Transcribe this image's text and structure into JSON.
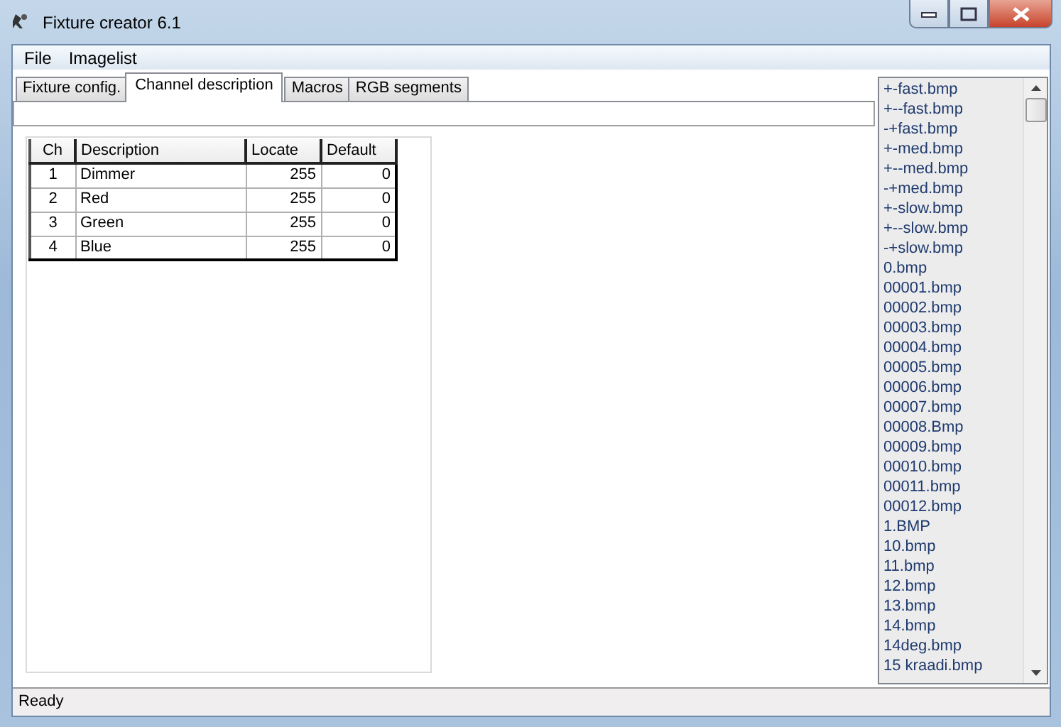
{
  "window": {
    "title": "Fixture creator 6.1"
  },
  "menu": [
    "File",
    "Imagelist"
  ],
  "tabs": [
    {
      "label": "Fixture config.",
      "selected": false
    },
    {
      "label": "Channel description",
      "selected": true
    },
    {
      "label": "Macros",
      "selected": false
    },
    {
      "label": "RGB segments",
      "selected": false
    }
  ],
  "table": {
    "columns": [
      "Ch",
      "Description",
      "Locate",
      "Default"
    ],
    "rows": [
      [
        "1",
        "Dimmer",
        "255",
        "0"
      ],
      [
        "2",
        "Red",
        "255",
        "0"
      ],
      [
        "3",
        "Green",
        "255",
        "0"
      ],
      [
        "4",
        "Blue",
        "255",
        "0"
      ]
    ]
  },
  "imagelist": [
    "+-fast.bmp",
    "+--fast.bmp",
    "-+fast.bmp",
    "+-med.bmp",
    "+--med.bmp",
    "-+med.bmp",
    "+-slow.bmp",
    "+--slow.bmp",
    "-+slow.bmp",
    "0.bmp",
    "00001.bmp",
    "00002.bmp",
    "00003.bmp",
    "00004.bmp",
    "00005.bmp",
    "00006.bmp",
    "00007.bmp",
    "00008.Bmp",
    "00009.bmp",
    "00010.bmp",
    "00011.bmp",
    "00012.bmp",
    "1.BMP",
    "10.bmp",
    "11.bmp",
    "12.bmp",
    "13.bmp",
    "14.bmp",
    "14deg.bmp",
    "15 kraadi.bmp"
  ],
  "status_bar": "Ready"
}
